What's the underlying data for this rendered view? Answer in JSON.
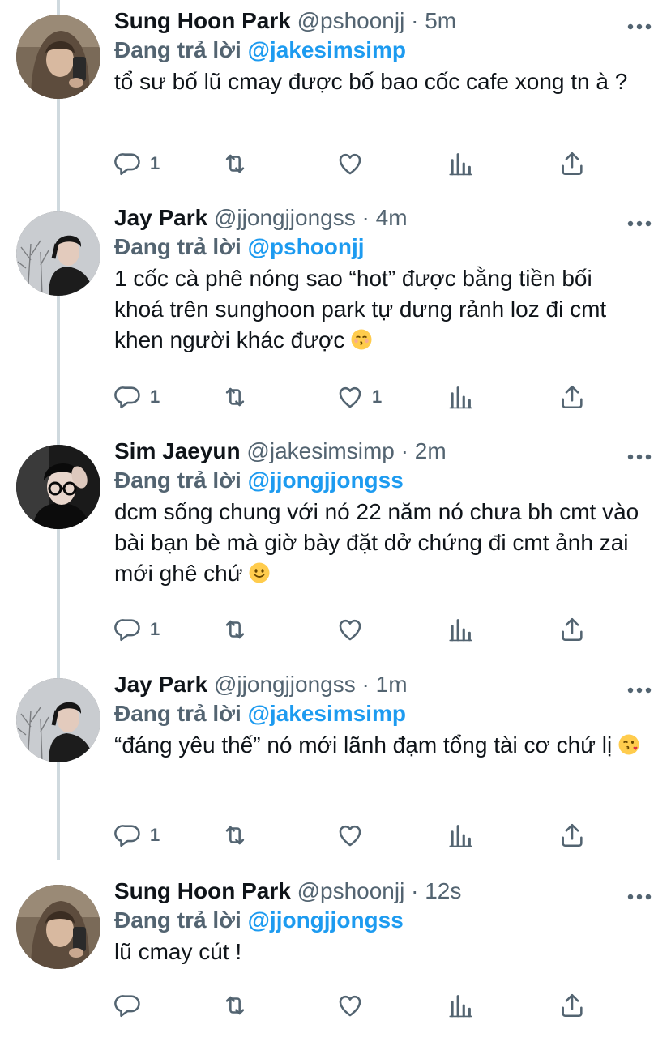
{
  "reply_prefix": "Đang trả lời",
  "colors": {
    "accent": "#1d9bf0",
    "text": "#0f1419",
    "secondary": "#536471",
    "thread_line": "#cfd9de"
  },
  "tweets": [
    {
      "name": "Sung Hoon Park",
      "handle": "@pshoonjj",
      "dot": "·",
      "time": "5m",
      "reply_to": "@jakesimsimp",
      "text": "tổ sư bố lũ cmay được bố bao cốc cafe xong tn à ?",
      "emoji": "",
      "replies": "1",
      "retweets": "",
      "likes": "",
      "avatar_icon": "profile-photo-hood"
    },
    {
      "name": "Jay Park",
      "handle": "@jjongjjongss",
      "dot": "·",
      "time": "4m",
      "reply_to": "@pshoonjj",
      "text": "1 cốc cà phê nóng sao “hot” được bằng tiền bối khoá trên sunghoon park tự dưng rảnh loz đi cmt khen người khác được",
      "emoji": "kissing-face-emoji",
      "replies": "1",
      "retweets": "",
      "likes": "1",
      "avatar_icon": "profile-photo-trees"
    },
    {
      "name": "Sim Jaeyun",
      "handle": "@jakesimsimp",
      "dot": "·",
      "time": "2m",
      "reply_to": "@jjongjjongss",
      "text": "dcm sống chung với nó 22 năm nó chưa bh cmt vào bài bạn bè mà giờ bày đặt dở chứng đi cmt ảnh zai mới ghê chứ",
      "emoji": "slightly-smiling-face-emoji",
      "replies": "1",
      "retweets": "",
      "likes": "",
      "avatar_icon": "profile-photo-glasses"
    },
    {
      "name": "Jay Park",
      "handle": "@jjongjjongss",
      "dot": "·",
      "time": "1m",
      "reply_to": "@jakesimsimp",
      "text": "“đáng yêu thế” nó mới lãnh đạm tổng tài cơ chứ lị",
      "emoji": "face-blowing-kiss-emoji",
      "replies": "1",
      "retweets": "",
      "likes": "",
      "avatar_icon": "profile-photo-trees"
    },
    {
      "name": "Sung Hoon Park",
      "handle": "@pshoonjj",
      "dot": "·",
      "time": "12s",
      "reply_to": "@jjongjjongss",
      "text": "lũ cmay cút !",
      "emoji": "",
      "replies": "",
      "retweets": "",
      "likes": "",
      "avatar_icon": "profile-photo-hood"
    }
  ]
}
